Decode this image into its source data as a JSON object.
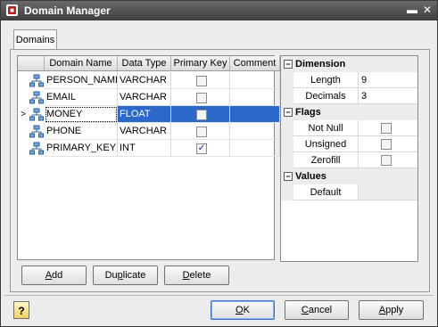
{
  "window": {
    "title": "Domain Manager",
    "app_icon": "app-logo-icon"
  },
  "tabs": [
    {
      "label": "Domains"
    }
  ],
  "grid": {
    "columns": [
      "Domain Name",
      "Data Type",
      "Primary Key",
      "Comment"
    ],
    "rows": [
      {
        "name": "PERSON_NAME",
        "type": "VARCHAR",
        "primary_key": false,
        "comment": ""
      },
      {
        "name": "EMAIL",
        "type": "VARCHAR",
        "primary_key": false,
        "comment": ""
      },
      {
        "name": "MONEY",
        "type": "FLOAT",
        "primary_key": false,
        "comment": "",
        "selected": true
      },
      {
        "name": "PHONE",
        "type": "VARCHAR",
        "primary_key": false,
        "comment": ""
      },
      {
        "name": "PRIMARY_KEY",
        "type": "INT",
        "primary_key": true,
        "comment": ""
      }
    ],
    "row_indicator": ">"
  },
  "properties": {
    "dimension": {
      "label": "Dimension",
      "length_label": "Length",
      "length_value": "9",
      "decimals_label": "Decimals",
      "decimals_value": "3"
    },
    "flags": {
      "label": "Flags",
      "not_null_label": "Not Null",
      "unsigned_label": "Unsigned",
      "zerofill_label": "Zerofill"
    },
    "values": {
      "label": "Values",
      "default_label": "Default",
      "default_value": ""
    }
  },
  "buttons": {
    "add": {
      "pre": "",
      "ul": "A",
      "post": "dd"
    },
    "duplicate": {
      "pre": "Du",
      "ul": "p",
      "post": "licate"
    },
    "delete": {
      "pre": "",
      "ul": "D",
      "post": "elete"
    },
    "ok": {
      "pre": "",
      "ul": "O",
      "post": "K"
    },
    "cancel": {
      "pre": "",
      "ul": "C",
      "post": "ancel"
    },
    "apply": {
      "pre": "",
      "ul": "A",
      "post": "pply"
    },
    "help": "?"
  },
  "colors": {
    "selection": "#2a68c9",
    "titlebar": "#4a4a4a"
  }
}
